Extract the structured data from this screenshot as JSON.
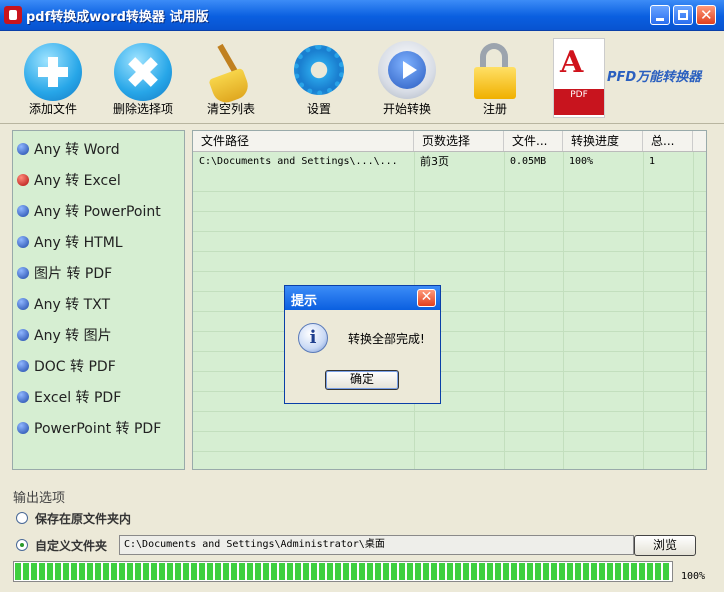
{
  "window": {
    "title": "pdf转换成word转换器 试用版"
  },
  "toolbar": {
    "add_file": "添加文件",
    "remove_selected": "删除选择项",
    "clear_list": "清空列表",
    "settings": "设置",
    "start_convert": "开始转换",
    "register": "注册",
    "brand_title": "PFD万能转换器",
    "pdf_badge": "PDF"
  },
  "sidebar": {
    "items": [
      {
        "label": "Any 转 Word",
        "selected": false
      },
      {
        "label": "Any 转 Excel",
        "selected": true
      },
      {
        "label": "Any 转 PowerPoint",
        "selected": false
      },
      {
        "label": "Any 转 HTML",
        "selected": false
      },
      {
        "label": "图片 转 PDF",
        "selected": false
      },
      {
        "label": "Any 转 TXT",
        "selected": false
      },
      {
        "label": "Any 转 图片",
        "selected": false
      },
      {
        "label": "DOC 转 PDF",
        "selected": false
      },
      {
        "label": "Excel 转 PDF",
        "selected": false
      },
      {
        "label": "PowerPoint 转 PDF",
        "selected": false
      }
    ]
  },
  "table": {
    "columns": [
      "文件路径",
      "页数选择",
      "文件...",
      "转换进度",
      "总..."
    ],
    "rows": [
      [
        "C:\\Documents and Settings\\...\\...",
        "前3页",
        "0.05MB",
        "100%",
        "1"
      ]
    ]
  },
  "dialog": {
    "title": "提示",
    "message": "转换全部完成!",
    "ok": "确定",
    "icon": "info-icon"
  },
  "output": {
    "section_title": "输出选项",
    "option_original": "保存在原文件夹内",
    "option_custom": "自定义文件夹",
    "selected_option": "custom",
    "path": "C:\\Documents and Settings\\Administrator\\桌面",
    "browse": "浏览"
  },
  "progress": {
    "value": 1.0,
    "label": "100%"
  },
  "colors": {
    "title_bar": "#0a5fe0",
    "panel_bg": "#d6eed2",
    "progress": "#3fcf3f"
  }
}
